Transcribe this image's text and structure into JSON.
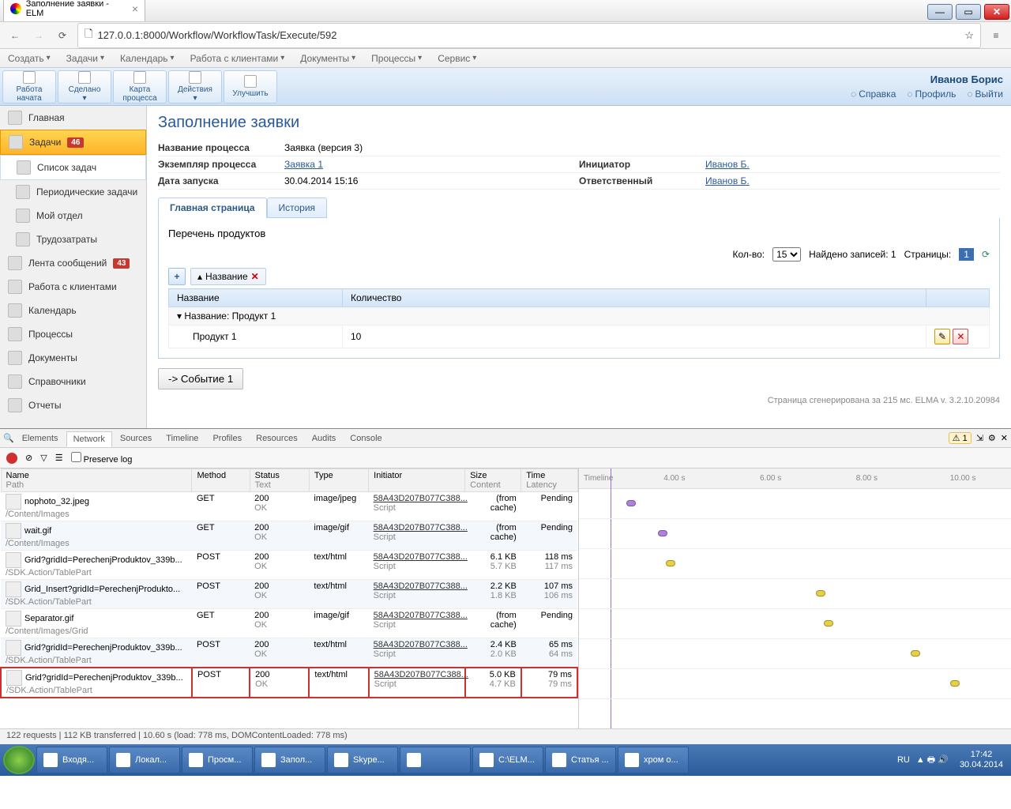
{
  "browser": {
    "tab_title": "Заполнение заявки - ELM",
    "url": "127.0.0.1:8000/Workflow/WorkflowTask/Execute/592"
  },
  "app_menu": [
    "Создать",
    "Задачи",
    "Календарь",
    "Работа с клиентами",
    "Документы",
    "Процессы",
    "Сервис"
  ],
  "ribbon": {
    "buttons": [
      {
        "l1": "Работа",
        "l2": "начата"
      },
      {
        "l1": "Сделано",
        "l2": "▾"
      },
      {
        "l1": "Карта",
        "l2": "процесса"
      },
      {
        "l1": "Действия",
        "l2": "▾"
      },
      {
        "l1": "Улучшить",
        "l2": ""
      }
    ],
    "user": "Иванов Борис",
    "links": [
      "Справка",
      "Профиль",
      "Выйти"
    ]
  },
  "sidebar": [
    {
      "label": "Главная"
    },
    {
      "label": "Задачи",
      "badge": "46",
      "active": true
    },
    {
      "label": "Список задач",
      "sub": true,
      "sel": true
    },
    {
      "label": "Периодические задачи",
      "sub": true
    },
    {
      "label": "Мой отдел",
      "sub": true
    },
    {
      "label": "Трудозатраты",
      "sub": true
    },
    {
      "label": "Лента сообщений",
      "badge": "43"
    },
    {
      "label": "Работа с клиентами"
    },
    {
      "label": "Календарь"
    },
    {
      "label": "Процессы"
    },
    {
      "label": "Документы"
    },
    {
      "label": "Справочники"
    },
    {
      "label": "Отчеты"
    }
  ],
  "page": {
    "title": "Заполнение заявки",
    "process_name_label": "Название процесса",
    "process_name": "Заявка (версия 3)",
    "instance_label": "Экземпляр процесса",
    "instance": "Заявка 1",
    "initiator_label": "Инициатор",
    "initiator": "Иванов Б.",
    "start_label": "Дата запуска",
    "start": "30.04.2014 15:16",
    "resp_label": "Ответственный",
    "resp": "Иванов Б.",
    "tabs": [
      "Главная страница",
      "История"
    ],
    "list_title": "Перечень продуктов",
    "qty_label": "Кол-во:",
    "qty": "15",
    "found": "Найдено записей: 1",
    "pages_label": "Страницы:",
    "page_num": "1",
    "filter": "Название",
    "cols": [
      "Название",
      "Количество"
    ],
    "group": "Название: Продукт 1",
    "row": {
      "name": "Продукт 1",
      "qty": "10"
    },
    "event_btn": "-> Событие 1",
    "footer": "Страница сгенерирована за 215 мс. ELMA v. 3.2.10.20984"
  },
  "devtools": {
    "tabs": [
      "Elements",
      "Network",
      "Sources",
      "Timeline",
      "Profiles",
      "Resources",
      "Audits",
      "Console"
    ],
    "warn": "1",
    "preserve": "Preserve log",
    "cols": [
      {
        "h": "Name",
        "s": "Path"
      },
      {
        "h": "Method",
        "s": ""
      },
      {
        "h": "Status",
        "s": "Text"
      },
      {
        "h": "Type",
        "s": ""
      },
      {
        "h": "Initiator",
        "s": ""
      },
      {
        "h": "Size",
        "s": "Content"
      },
      {
        "h": "Time",
        "s": "Latency"
      }
    ],
    "tl_label": "Timeline",
    "tl_ticks": [
      "4.00 s",
      "6.00 s",
      "8.00 s",
      "10.00 s"
    ],
    "rows": [
      {
        "name": "nophoto_32.jpeg",
        "path": "/Content/Images",
        "method": "GET",
        "status": "200",
        "stext": "OK",
        "type": "image/jpeg",
        "init": "58A43D207B077C388...",
        "itext": "Script",
        "size": "(from cache)",
        "scontent": "",
        "time": "Pending",
        "lat": "",
        "dotColor": "#b080e0",
        "dotLeft": 60
      },
      {
        "name": "wait.gif",
        "path": "/Content/Images",
        "method": "GET",
        "status": "200",
        "stext": "OK",
        "type": "image/gif",
        "init": "58A43D207B077C388...",
        "itext": "Script",
        "size": "(from cache)",
        "scontent": "",
        "time": "Pending",
        "lat": "",
        "dotColor": "#b080e0",
        "dotLeft": 100,
        "alt": true
      },
      {
        "name": "Grid?gridId=PerechenjProduktov_339b...",
        "path": "/SDK.Action/TablePart",
        "method": "POST",
        "status": "200",
        "stext": "OK",
        "type": "text/html",
        "init": "58A43D207B077C388...",
        "itext": "Script",
        "size": "6.1 KB",
        "scontent": "5.7 KB",
        "time": "118 ms",
        "lat": "117 ms",
        "dotColor": "#e8d040",
        "dotLeft": 110
      },
      {
        "name": "Grid_Insert?gridId=PerechenjProdukto...",
        "path": "/SDK.Action/TablePart",
        "method": "POST",
        "status": "200",
        "stext": "OK",
        "type": "text/html",
        "init": "58A43D207B077C388...",
        "itext": "Script",
        "size": "2.2 KB",
        "scontent": "1.8 KB",
        "time": "107 ms",
        "lat": "106 ms",
        "dotColor": "#e8d040",
        "dotLeft": 300,
        "alt": true
      },
      {
        "name": "Separator.gif",
        "path": "/Content/Images/Grid",
        "method": "GET",
        "status": "200",
        "stext": "OK",
        "type": "image/gif",
        "init": "58A43D207B077C388...",
        "itext": "Script",
        "size": "(from cache)",
        "scontent": "",
        "time": "Pending",
        "lat": "",
        "dotColor": "#e8d040",
        "dotLeft": 310
      },
      {
        "name": "Grid?gridId=PerechenjProduktov_339b...",
        "path": "/SDK.Action/TablePart",
        "method": "POST",
        "status": "200",
        "stext": "OK",
        "type": "text/html",
        "init": "58A43D207B077C388...",
        "itext": "Script",
        "size": "2.4 KB",
        "scontent": "2.0 KB",
        "time": "65 ms",
        "lat": "64 ms",
        "dotColor": "#e8d040",
        "dotLeft": 420,
        "alt": true
      },
      {
        "name": "Grid?gridId=PerechenjProduktov_339b...",
        "path": "/SDK.Action/TablePart",
        "method": "POST",
        "status": "200",
        "stext": "OK",
        "type": "text/html",
        "init": "58A43D207B077C388...",
        "itext": "Script",
        "size": "5.0 KB",
        "scontent": "4.7 KB",
        "time": "79 ms",
        "lat": "79 ms",
        "dotColor": "#e8d040",
        "dotLeft": 470,
        "hl": true
      }
    ],
    "status": "122 requests | 112 KB transferred | 10.60 s (load: 778 ms, DOMContentLoaded: 778 ms)"
  },
  "taskbar": {
    "items": [
      "Входя...",
      "Локал...",
      "Просм...",
      "Запол...",
      "Skype...",
      "",
      "C:\\ELM...",
      "Статья ...",
      "хром о..."
    ],
    "lang": "RU",
    "time": "17:42",
    "date": "30.04.2014"
  }
}
